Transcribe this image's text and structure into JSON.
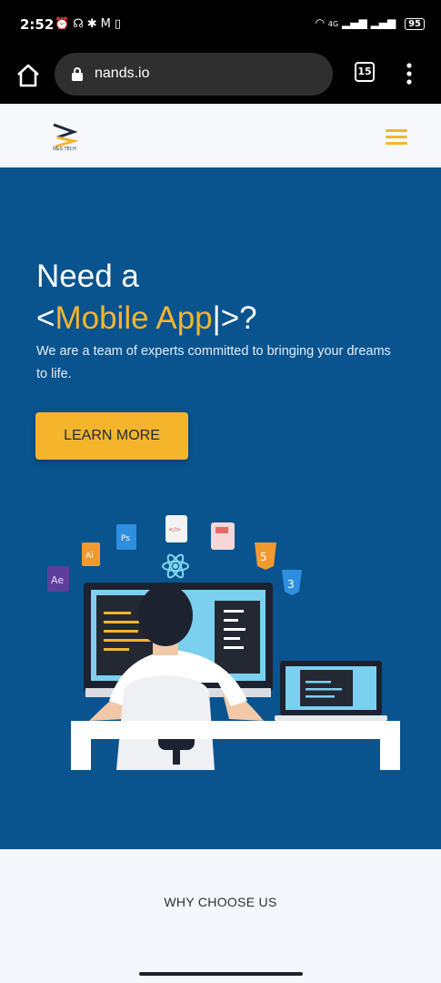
{
  "status_bar": {
    "time": "2:52",
    "left_icons": [
      "alarm-icon",
      "headphones-icon",
      "settings-icon",
      "gmail-icon",
      "phone-icon"
    ],
    "network": "4G",
    "battery": "95"
  },
  "browser": {
    "url": "nands.io",
    "tab_count": "15"
  },
  "site": {
    "logo_text": "N&S TECH",
    "hero": {
      "line1": "Need a",
      "prefix": "<",
      "typed": "Mobile App",
      "cursor": "|",
      "suffix": ">?",
      "description": "We are a team of experts committed to bringing your dreams to life.",
      "cta_label": "LEARN MORE"
    },
    "section_title": "WHY CHOOSE US",
    "illustration_badges": {
      "ae": "Ae",
      "ai": "Ai",
      "ps": "Ps",
      "html5": "5",
      "css3": "3",
      "code": "</>"
    }
  },
  "colors": {
    "hero_bg": "#09548f",
    "accent": "#f4b52d",
    "header_bg": "#f6f8fb",
    "chrome_bg": "#000000"
  }
}
